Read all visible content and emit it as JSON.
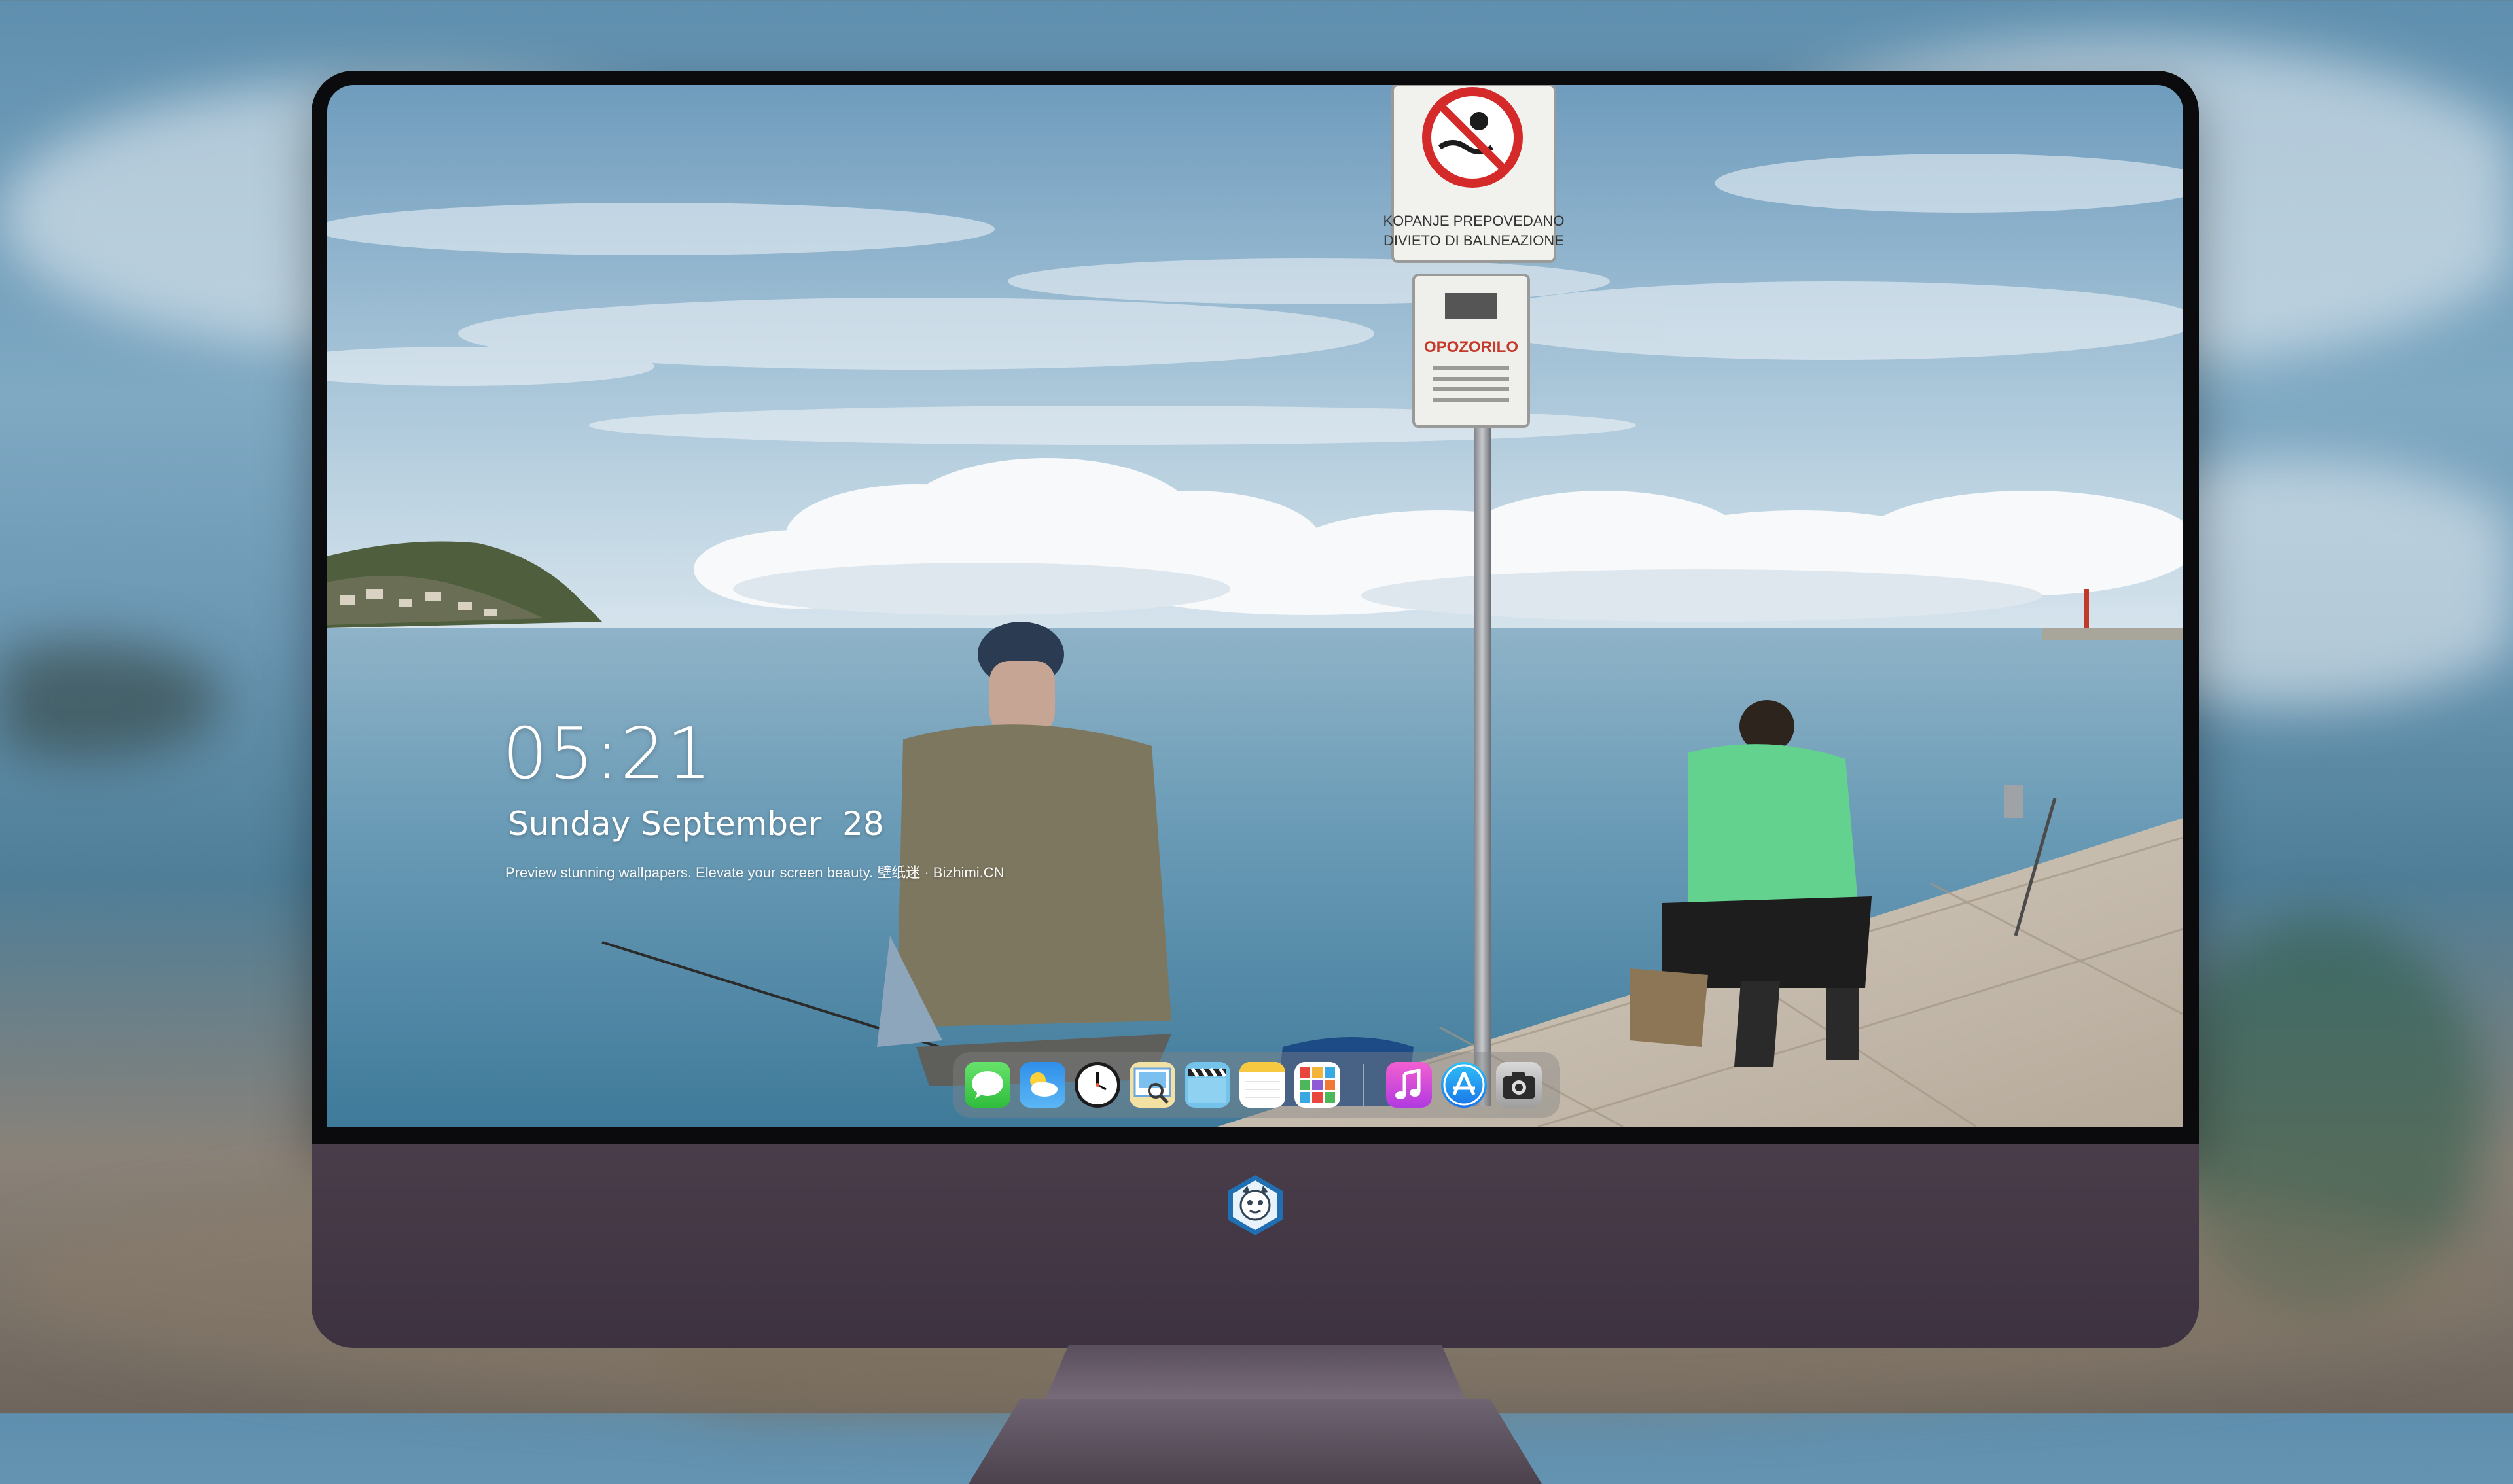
{
  "lockscreen": {
    "time": "05:21",
    "date": "Sunday September  28",
    "tagline": "Preview stunning wallpapers. Elevate your screen beauty. 壁纸迷 · Bizhimi.CN"
  },
  "wallpaper": {
    "sign_top_line1": "KOPANJE PREPOVEDANO",
    "sign_top_line2": "DIVIETO DI BALNEAZIONE",
    "sign_bottom_title": "OPOZORILO"
  },
  "dock": {
    "apps": [
      {
        "name": "Messages",
        "icon": "messages-icon"
      },
      {
        "name": "Weather",
        "icon": "weather-icon"
      },
      {
        "name": "Clock",
        "icon": "clock-icon"
      },
      {
        "name": "Preview",
        "icon": "preview-icon"
      },
      {
        "name": "Clips",
        "icon": "clips-icon"
      },
      {
        "name": "Notes",
        "icon": "notes-icon"
      },
      {
        "name": "Photo Booth",
        "icon": "photo-grid-icon"
      },
      {
        "name": "iTunes",
        "icon": "music-icon"
      },
      {
        "name": "App Store",
        "icon": "app-store-icon"
      },
      {
        "name": "Camera",
        "icon": "camera-icon"
      }
    ]
  },
  "colors": {
    "sky": "#7fa8c6",
    "sea": "#5e94b0",
    "pier": "#c9bfb1",
    "monitor_chin": "#3f3442",
    "bezel": "#0b0b0d"
  }
}
